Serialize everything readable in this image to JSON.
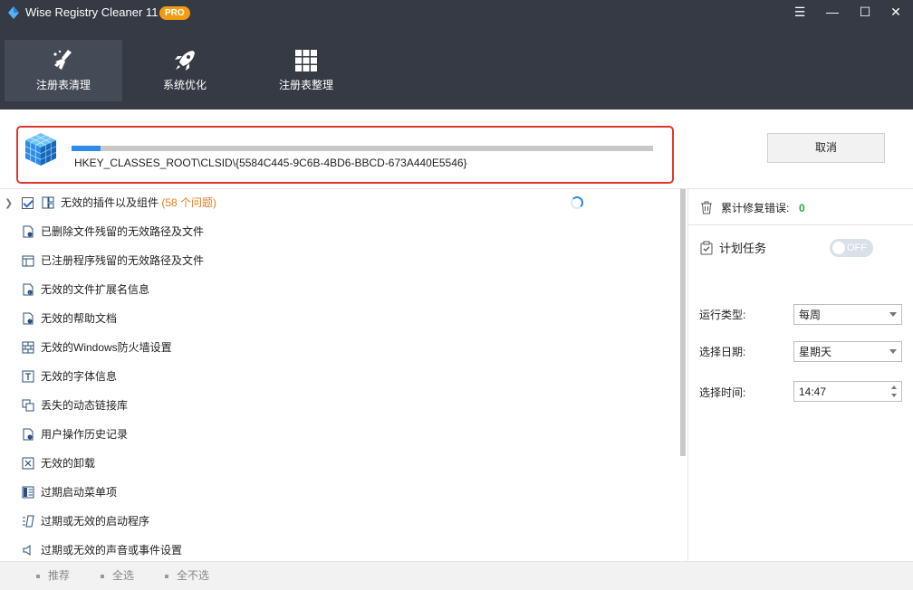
{
  "window": {
    "title": "Wise Registry Cleaner 11",
    "badge": "PRO",
    "menu_glyph": "☰",
    "min_glyph": "—",
    "max_glyph": "☐",
    "close_glyph": "✕"
  },
  "nav": {
    "tabs": [
      {
        "label": "注册表清理",
        "icon": "broom-icon",
        "active": true
      },
      {
        "label": "系统优化",
        "icon": "rocket-icon",
        "active": false
      },
      {
        "label": "注册表整理",
        "icon": "grid-icon",
        "active": false
      }
    ]
  },
  "scan": {
    "progress": 0.05,
    "path": "HKEY_CLASSES_ROOT\\CLSID\\{5584C445-9C6B-4BD6-BBCD-673A440E5546}",
    "cancel_label": "取消"
  },
  "items": [
    {
      "label": "无效的插件以及组件",
      "count": "(58 个问题)",
      "icon": "component-icon"
    },
    {
      "label": "已删除文件残留的无效路径及文件",
      "icon": "file-path-icon"
    },
    {
      "label": "已注册程序残留的无效路径及文件",
      "icon": "program-path-icon"
    },
    {
      "label": "无效的文件扩展名信息",
      "icon": "file-extension-icon"
    },
    {
      "label": "无效的帮助文档",
      "icon": "help-doc-icon"
    },
    {
      "label": "无效的Windows防火墙设置",
      "icon": "firewall-icon"
    },
    {
      "label": "无效的字体信息",
      "icon": "font-icon"
    },
    {
      "label": "丢失的动态链接库",
      "icon": "dll-icon"
    },
    {
      "label": "用户操作历史记录",
      "icon": "history-icon"
    },
    {
      "label": "无效的卸载",
      "icon": "uninstall-icon"
    },
    {
      "label": "过期启动菜单项",
      "icon": "start-menu-icon"
    },
    {
      "label": "过期或无效的启动程序",
      "icon": "startup-icon"
    },
    {
      "label": "过期或无效的声音或事件设置",
      "icon": "sound-icon"
    }
  ],
  "right_panel": {
    "fixed_errors_label": "累计修复错误:",
    "fixed_errors_value": "0",
    "schedule_label": "计划任务",
    "toggle_label": "OFF",
    "run_type_label": "运行类型:",
    "run_type_value": "每周",
    "date_label": "选择日期:",
    "date_value": "星期天",
    "time_label": "选择时间:",
    "time_value": "14:47"
  },
  "footer": {
    "recommend": "推荐",
    "select_all": "全选",
    "select_none": "全不选"
  },
  "colors": {
    "header_bg": "#353a45",
    "accent": "#2f8be6",
    "highlight_border": "#e0382b",
    "issue_count": "#e67e22",
    "badge": "#f39c12"
  }
}
